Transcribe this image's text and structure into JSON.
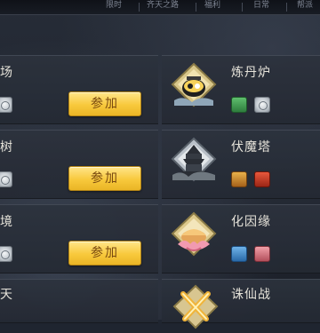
{
  "topbar": {
    "tabs": [
      "限时",
      "齐天之路",
      "福利",
      "日常",
      "帮派"
    ]
  },
  "left_cards": [
    {
      "title_fragment": "场",
      "button_label": "参加"
    },
    {
      "title_fragment": "树",
      "button_label": "参加"
    },
    {
      "title_fragment": "境",
      "button_label": "参加"
    },
    {
      "title_fragment": "天"
    }
  ],
  "right_cards": [
    {
      "title": "炼丹炉",
      "icon": "alchemy-furnace-icon"
    },
    {
      "title": "伏魔塔",
      "icon": "demon-tower-icon"
    },
    {
      "title": "化因缘",
      "icon": "lotus-bowl-icon"
    },
    {
      "title": "诛仙战",
      "icon": "crossed-swords-icon"
    }
  ],
  "colors": {
    "button_gold": "#f8c93c",
    "button_text": "#7a4a10",
    "card_bg": "#2c323d",
    "title_text": "#e6e3da"
  }
}
